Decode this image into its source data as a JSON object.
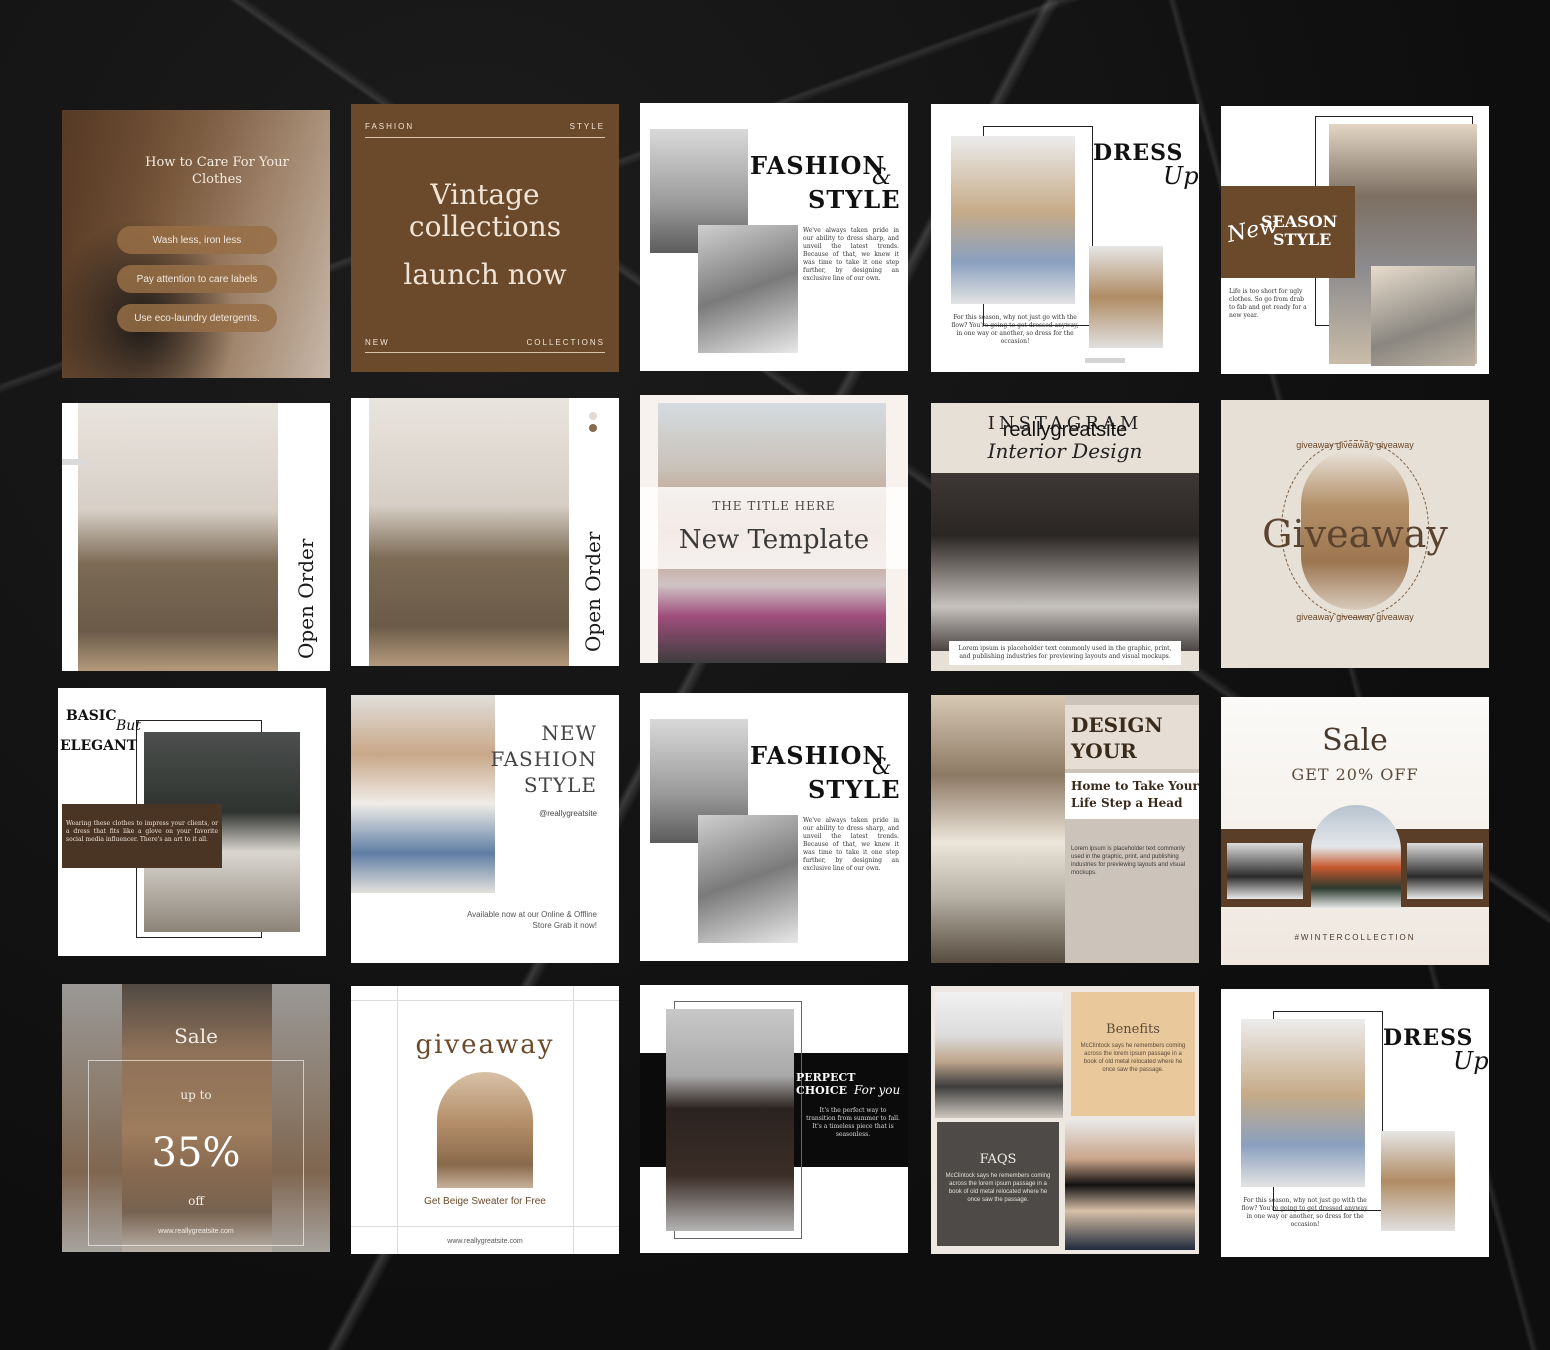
{
  "tiles": {
    "t1": {
      "title": "How to Care For Your Clothes",
      "tips": [
        "Wash less, iron less",
        "Pay attention to care labels",
        "Use eco-laundry detergents."
      ]
    },
    "t2": {
      "top_left": "FASHION",
      "top_right": "STYLE",
      "line1": "Vintage",
      "line2": "collections",
      "line3": "launch now",
      "bottom_left": "NEW",
      "bottom_right": "COLLECTIONS"
    },
    "t3": {
      "title1": "FASHION",
      "amp": "&",
      "title2": "STYLE",
      "body": "We've always taken pride in our ability to dress sharp, and unveil the latest trends. Because of that, we knew it was time to take it one step further, by designing an exclusive line of our own."
    },
    "t4": {
      "title": "DRESS",
      "script": "Up",
      "body": "For this season, why not just go with the flow? You're going to get dressed anyway, in one way or another, so dress for the occasion!"
    },
    "t5": {
      "script": "New",
      "title1": "SEASON",
      "title2": "STYLE",
      "body": "Life is too short for ugly clothes. So go from drab to fab and get ready for a new year."
    },
    "t6": {
      "vertical": "Open Order"
    },
    "t7": {
      "vertical": "Open Order"
    },
    "t8": {
      "kicker": "THE TITLE HERE",
      "title": "New Template"
    },
    "t9": {
      "title": "INSTAGRAM",
      "site": "reallygreatsite",
      "script": "Interior Design",
      "body": "Lorem ipsum is placeholder text commonly used in the graphic, print, and publishing industries for previewing layouts and visual mockups."
    },
    "t10": {
      "ring_top": "giveaway giveaway giveaway",
      "word": "Giveaway",
      "ring_bottom": "giveaway giveaway giveaway"
    },
    "t11": {
      "title1": "BASIC",
      "script": "But",
      "title2": "ELEGANT",
      "body": "Wearing these clothes to impress your clients, or a dress that fits like a glove on your favorite social media influencer. There's an art to it all."
    },
    "t12": {
      "title1": "NEW",
      "title2": "FASHION",
      "title3": "STYLE",
      "handle": "@reallygreatsite",
      "body": "Available now at our Online & Offline Store Grab it now!"
    },
    "t13": {
      "title1": "FASHION",
      "amp": "&",
      "title2": "STYLE",
      "body": "We've always taken pride in our ability to dress sharp, and unveil the latest trends. Because of that, we knew it was time to take it one step further, by designing an exclusive line of our own."
    },
    "t14": {
      "title1": "DESIGN",
      "title2": "YOUR",
      "subtitle1": "Home to Take Your",
      "subtitle2": "Life Step a Head",
      "body": "Lorem ipsum is placeholder text commonly used in the graphic, print, and publishing industries for previewing layouts and visual mockups."
    },
    "t15": {
      "title": "Sale",
      "offer": "GET 20% OFF",
      "tag": "#WINTERCOLLECTION"
    },
    "t16": {
      "title": "Sale",
      "upto": "up to",
      "percent": "35%",
      "off": "off",
      "site": "www.reallygreatsite.com"
    },
    "t17": {
      "title": "giveaway",
      "body": "Get Beige Sweater for Free",
      "site": "www.reallygreatsite.com"
    },
    "t18": {
      "title": "PERPECT CHOICE",
      "script": "For you",
      "body": "It's the perfect way to transition from summer to fall. It's a timeless piece that is seasonless."
    },
    "t19": {
      "h1": "Benefits",
      "b1": "McClintock says he remembers coming across the lorem ipsum passage in a book of old metal relocated where he once saw the passage.",
      "h2": "FAQS",
      "b2": "McClintock says he remembers coming across the lorem ipsum passage in a book of old metal relocated where he once saw the passage."
    },
    "t20": {
      "title": "DRESS",
      "script": "Up",
      "body": "For this season, why not just go with the flow? You're going to get dressed anyway, in one way or another, so dress for the occasion!"
    }
  },
  "colors": {
    "brown": "#6b4a2b",
    "dark_brown": "#4a3424",
    "beige": "#e6ded5",
    "tan": "#e9c99b",
    "charcoal": "#4d4a47"
  }
}
